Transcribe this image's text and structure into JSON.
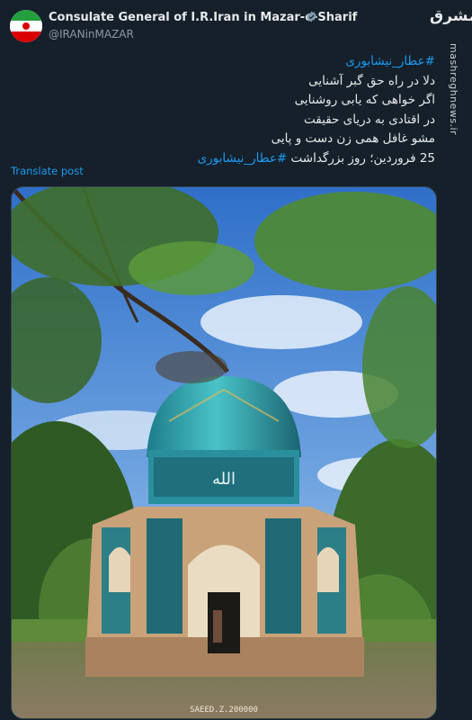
{
  "account": {
    "display_name": "Consulate General of I.R.Iran in Mazar-e-Sharif",
    "handle": "@IRANinMAZAR",
    "avatar_icon": "iran-flag-avatar",
    "verified_icon": "verified-badge-icon"
  },
  "watermark": {
    "logo": "مشرق",
    "text": "mashreghnews.ir"
  },
  "tweet": {
    "lines": [
      {
        "hashtag": "#عطار_نیشابوری",
        "text": ""
      },
      {
        "hashtag": "",
        "text": "دلا در راه حق گبر آشنایی"
      },
      {
        "hashtag": "",
        "text": "اگر خواهی که یابی روشنایی"
      },
      {
        "hashtag": "",
        "text": "در اقتادی به دریای حقیقت"
      },
      {
        "hashtag": "",
        "text": "مشو غافل همی زن دست و پایی"
      },
      {
        "hashtag": "#عطار_نیشابوری",
        "text": "25 فروردین؛ روز بزرگداشت "
      }
    ],
    "translate_label": "Translate post"
  },
  "media": {
    "description_icon": "attar-tomb-photo",
    "photo_credit": "SAEED.Z.200000"
  },
  "colors": {
    "background": "#15202b",
    "text": "#e7e9ea",
    "secondary": "#8b98a5",
    "link": "#1d9bf0"
  }
}
